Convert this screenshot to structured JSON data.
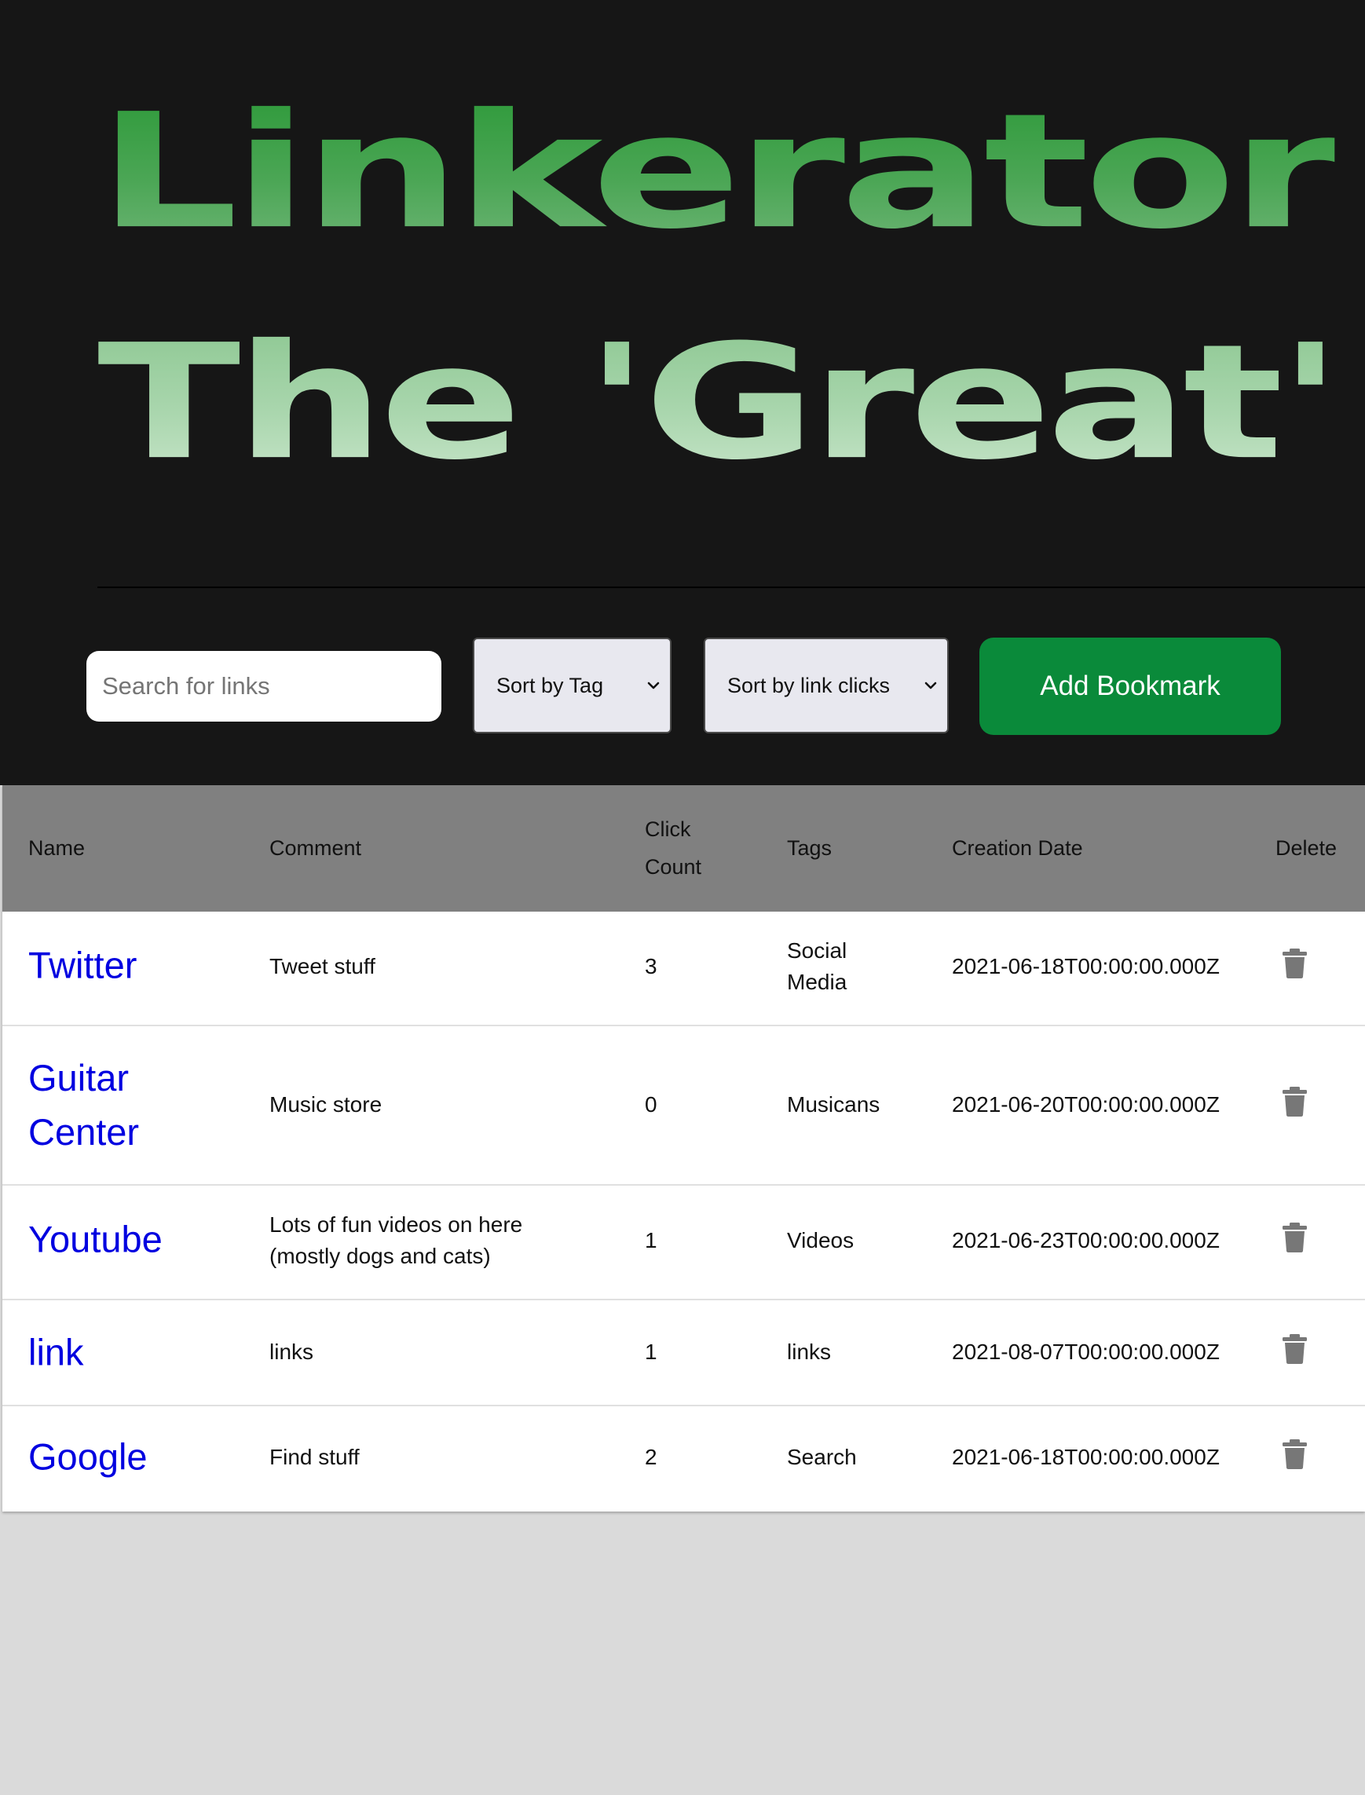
{
  "header": {
    "title_line1": "Linkerator",
    "title_line2": "The 'Great'"
  },
  "controls": {
    "search_placeholder": "Search for links",
    "search_value": "",
    "sort_tag_label": "Sort by Tag",
    "sort_clicks_label": "Sort by link clicks",
    "add_button_label": "Add Bookmark"
  },
  "table": {
    "columns": {
      "name": "Name",
      "comment": "Comment",
      "click_count_line1": "Click",
      "click_count_line2": "Count",
      "tags": "Tags",
      "creation_date": "Creation Date",
      "delete": "Delete"
    },
    "rows": [
      {
        "name": "Twitter",
        "comment": "Tweet stuff",
        "clicks": "3",
        "tags": "Social Media",
        "date": "2021-06-18T00:00:00.000Z",
        "delete_icon": "trash-icon"
      },
      {
        "name": "Guitar Center",
        "comment": "Music store",
        "clicks": "0",
        "tags": "Musicans",
        "date": "2021-06-20T00:00:00.000Z",
        "delete_icon": "trash-icon"
      },
      {
        "name": "Youtube",
        "comment": "Lots of fun videos on here (mostly dogs and cats)",
        "clicks": "1",
        "tags": "Videos",
        "date": "2021-06-23T00:00:00.000Z",
        "delete_icon": "trash-icon"
      },
      {
        "name": "link",
        "comment": "links",
        "clicks": "1",
        "tags": "links",
        "date": "2021-08-07T00:00:00.000Z",
        "delete_icon": "trash-icon"
      },
      {
        "name": "Google",
        "comment": "Find stuff",
        "clicks": "2",
        "tags": "Search",
        "date": "2021-06-18T00:00:00.000Z",
        "delete_icon": "trash-icon"
      }
    ]
  },
  "colors": {
    "header_bg": "#161616",
    "title_green": "#3b9f47",
    "subtitle_green": "#b4dcb8",
    "button_green": "#0a8a3a",
    "link_blue": "#0000e0",
    "table_header_bg": "#808080",
    "page_bg": "#dadada"
  }
}
